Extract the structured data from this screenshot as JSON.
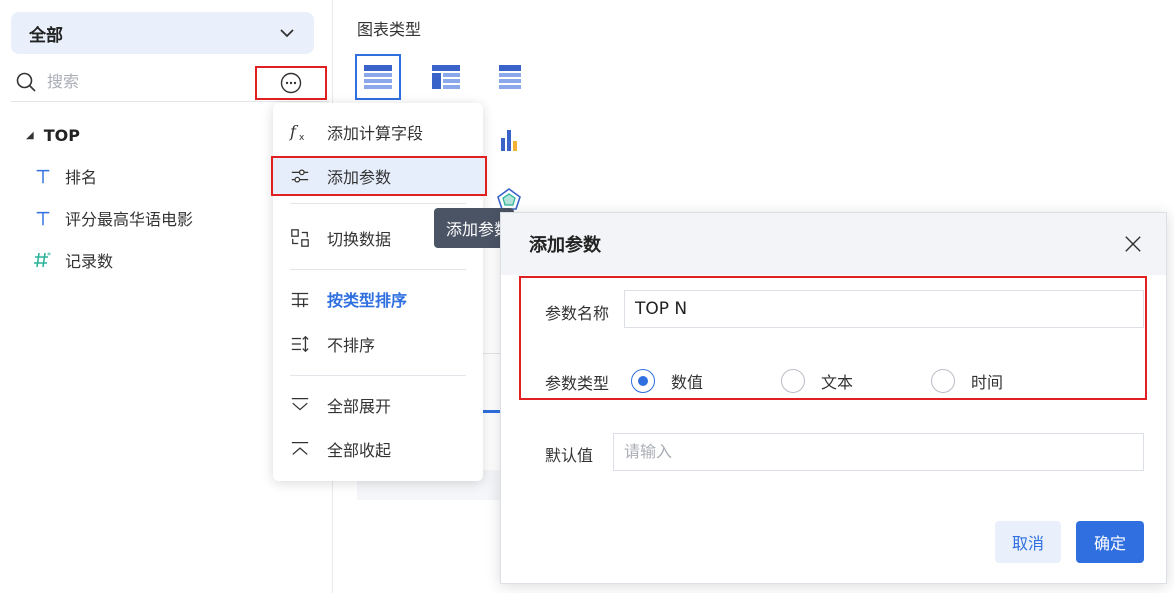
{
  "left_panel": {
    "dropdown_label": "全部",
    "search_placeholder": "搜索",
    "tree_root": "TOP",
    "fields": [
      {
        "label": "排名",
        "type": "text"
      },
      {
        "label": "评分最高华语电影",
        "type": "text"
      },
      {
        "label": "记录数",
        "type": "number"
      }
    ]
  },
  "middle": {
    "chart_type_label": "图表类型"
  },
  "menu": {
    "items": [
      {
        "label": "添加计算字段",
        "icon": "function-icon"
      },
      {
        "label": "添加参数",
        "icon": "sliders-icon"
      },
      {
        "label": "切换数据",
        "icon": "switch-data-icon"
      },
      {
        "label": "按类型排序",
        "icon": "sort-by-type-icon"
      },
      {
        "label": "不排序",
        "icon": "no-sort-icon"
      },
      {
        "label": "全部展开",
        "icon": "expand-all-icon"
      },
      {
        "label": "全部收起",
        "icon": "collapse-all-icon"
      }
    ]
  },
  "tooltip": {
    "text": "添加参数"
  },
  "dialog": {
    "title": "添加参数",
    "param_name_label": "参数名称",
    "param_name_value": "TOP N",
    "param_type_label": "参数类型",
    "types": [
      "数值",
      "文本",
      "时间"
    ],
    "selected_type": "数值",
    "default_label": "默认值",
    "default_placeholder": "请输入",
    "cancel_label": "取消",
    "ok_label": "确定"
  },
  "colors": {
    "accent": "#2f6fe0",
    "highlight_border": "#e02020",
    "field_text_icon": "#2f6fe0",
    "field_number_icon": "#2bb39a"
  }
}
